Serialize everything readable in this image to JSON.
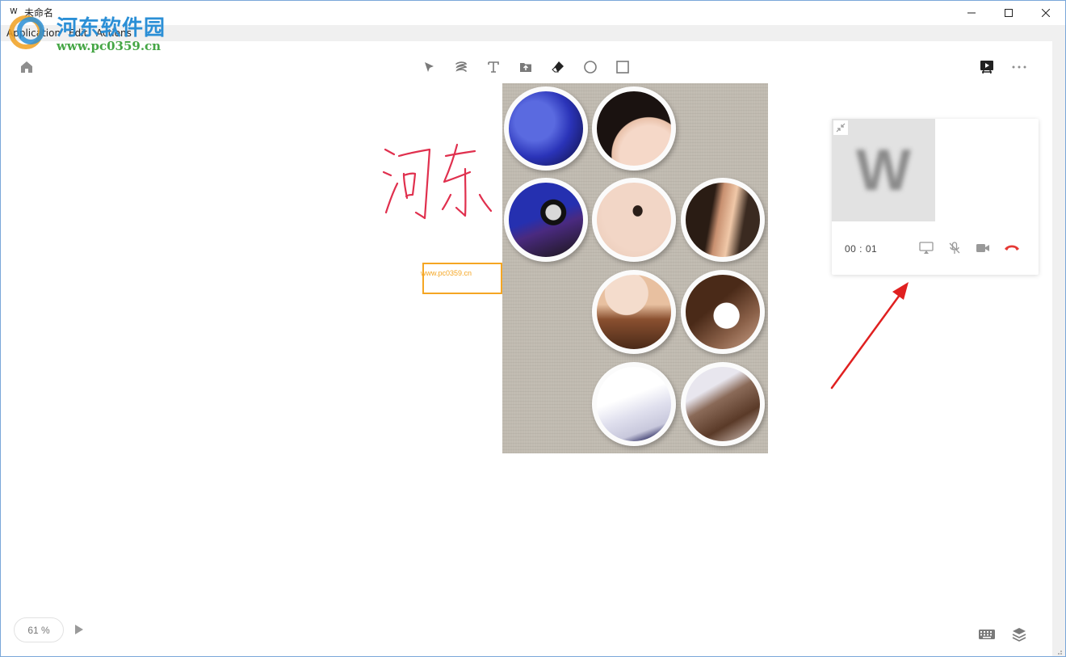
{
  "window": {
    "app_icon_glyph": "w",
    "title": "未命名",
    "controls": [
      "minimize-icon",
      "maximize-icon",
      "close-icon"
    ]
  },
  "menu": {
    "items": [
      {
        "label": "Application"
      },
      {
        "label": "Edit"
      },
      {
        "label": "Actions"
      }
    ]
  },
  "watermark": {
    "site_name": "河东软件园",
    "url": "www.pc0359.cn"
  },
  "toolbar": {
    "left": [
      "home-icon"
    ],
    "tools": [
      "select-icon",
      "pen-icon",
      "text-icon",
      "upload-icon",
      "eraser-icon",
      "circle-icon",
      "rectangle-icon"
    ],
    "right": [
      "present-icon",
      "more-icon"
    ]
  },
  "canvas": {
    "handwriting": "河东",
    "handwriting_color": "#e0304e",
    "textbox_text": "www.pc0359.cn",
    "textbox_color": "#f5a623",
    "photo_bubbles": 9
  },
  "call": {
    "avatar_letter": "W",
    "timer": "00 : 01",
    "buttons": [
      "screen-share-icon",
      "mic-off-icon",
      "camera-icon",
      "hangup-icon"
    ],
    "hangup_color": "#e53935"
  },
  "annotation": {
    "arrow_color": "#e02020"
  },
  "footer": {
    "zoom": "61 %",
    "icons": [
      "play-icon",
      "keyboard-icon",
      "layers-icon"
    ]
  }
}
